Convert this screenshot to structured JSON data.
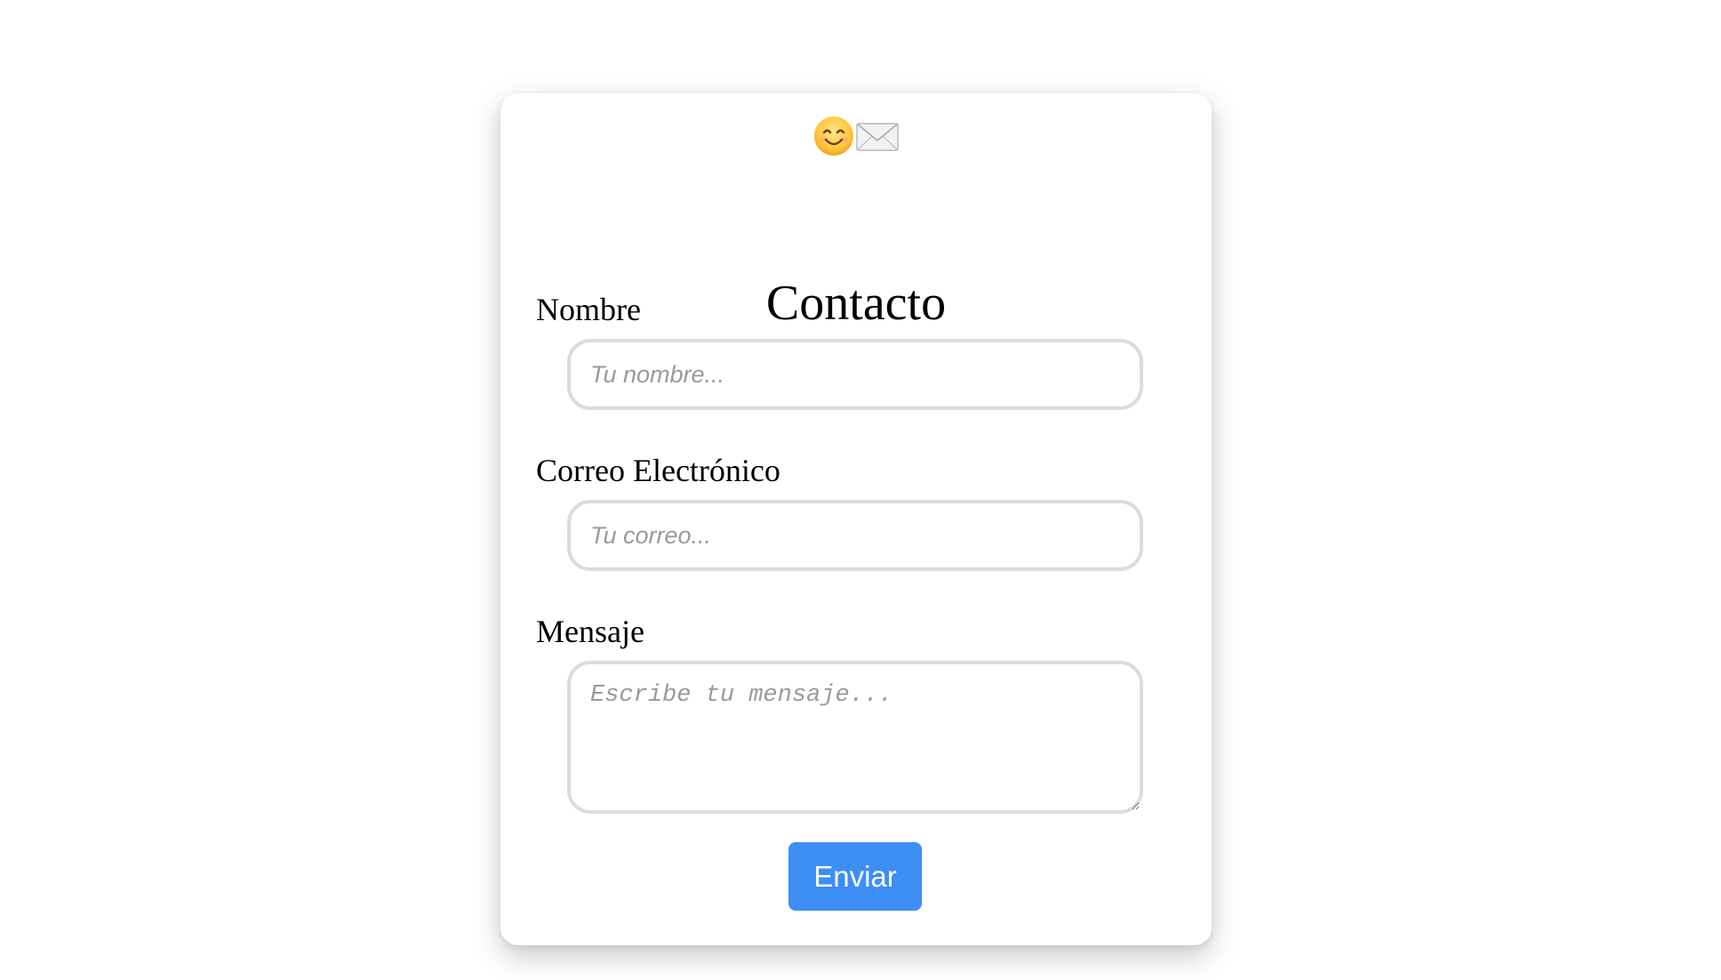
{
  "header": {
    "icons": [
      "smiling-face-icon",
      "envelope-icon"
    ],
    "title": "Contacto"
  },
  "form": {
    "name": {
      "label": "Nombre",
      "placeholder": "Tu nombre..."
    },
    "email": {
      "label": "Correo Electrónico",
      "placeholder": "Tu correo..."
    },
    "message": {
      "label": "Mensaje",
      "placeholder": "Escribe tu mensaje..."
    },
    "submit_label": "Enviar"
  },
  "colors": {
    "button": "#3d8ef5",
    "field_border": "#dcdcdc",
    "placeholder": "#9a9a9a"
  }
}
